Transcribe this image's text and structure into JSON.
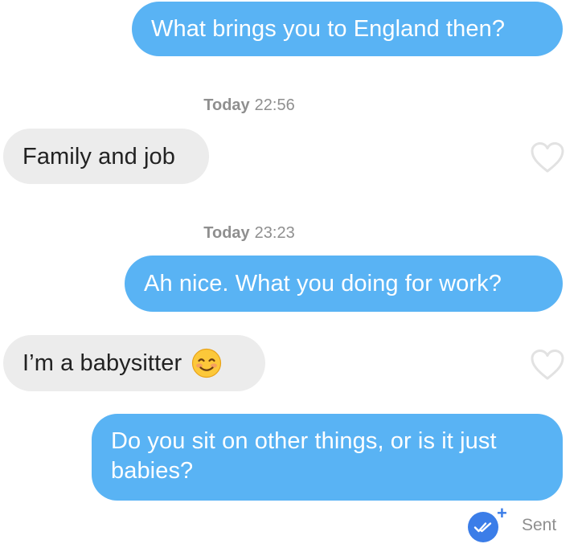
{
  "conversation": {
    "messages": [
      {
        "direction": "outgoing",
        "text": "What brings you to England then?"
      },
      {
        "direction": "incoming",
        "text": "Family and job"
      },
      {
        "direction": "outgoing",
        "text": "Ah nice. What you doing for work?"
      },
      {
        "direction": "incoming",
        "text": "I’m a babysitter",
        "emoji": "smiling-face-emoji"
      },
      {
        "direction": "outgoing",
        "text": "Do you sit on other things, or is it just babies?"
      }
    ],
    "timestamps": [
      {
        "day": "Today",
        "time": "22:56"
      },
      {
        "day": "Today",
        "time": "23:23"
      }
    ]
  },
  "icons": {
    "like": "heart-outline-icon",
    "read_receipt": "double-check-icon",
    "boost": "plus-icon"
  },
  "status": {
    "label": "Sent",
    "plus": "+"
  },
  "colors": {
    "outgoing_bubble": "#59b3f4",
    "incoming_bubble": "#ececec",
    "timestamp_text": "#8f8f8f",
    "read_receipt_badge": "#3b7de8"
  }
}
